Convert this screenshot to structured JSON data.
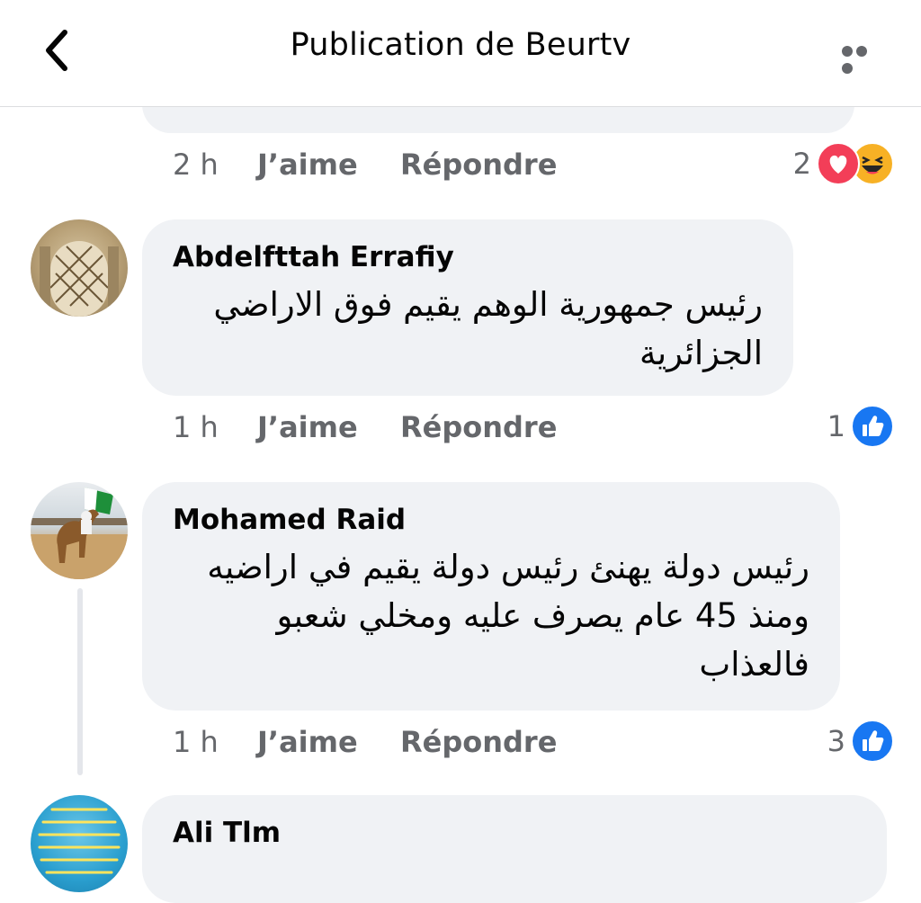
{
  "header": {
    "title": "Publication de Beurtv"
  },
  "prev_comment": {
    "time": "2 h",
    "like_label": "J’aime",
    "reply_label": "Répondre",
    "reaction_count": "2",
    "reactions": [
      "love-icon",
      "haha-icon"
    ]
  },
  "comments": [
    {
      "author": "Abdelfttah Errafiy",
      "text": "رئيس جمهورية الوهم يقيم فوق الاراضي\nالجزائرية",
      "time": "1 h",
      "like_label": "J’aime",
      "reply_label": "Répondre",
      "reaction_count": "1",
      "reactions": [
        "like-icon"
      ]
    },
    {
      "author": "Mohamed Raid",
      "text": "رئيس دولة يهنئ رئيس دولة يقيم في اراضيه\nومنذ 45 عام يصرف عليه ومخلي شعبو\nفالعذاب",
      "time": "1 h",
      "like_label": "J’aime",
      "reply_label": "Répondre",
      "reaction_count": "3",
      "reactions": [
        "like-icon"
      ]
    },
    {
      "author": "Ali Tlm"
    }
  ],
  "colors": {
    "bubble": "#f0f2f5",
    "secondary_text": "#65676b",
    "like_blue": "#1877f2",
    "love_red": "#f33e58",
    "haha_yellow": "#f7b125"
  }
}
